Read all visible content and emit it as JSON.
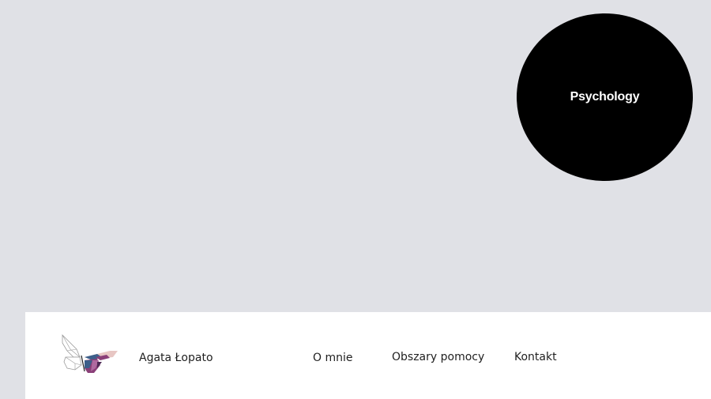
{
  "badge": {
    "label": "Psychology"
  },
  "header": {
    "brand_name": "Agata Łopato",
    "logo_icon": "butterfly-logo-icon",
    "nav": [
      {
        "label": "O mnie"
      },
      {
        "label": "Obszary pomocy"
      },
      {
        "label": "Kontakt"
      }
    ]
  },
  "colors": {
    "background": "#e0e1e6",
    "badge": "#000000",
    "header": "#ffffff",
    "logo_purple": "#8a3f78",
    "logo_blue": "#3c5f8a",
    "logo_pink": "#e7c6c3"
  }
}
